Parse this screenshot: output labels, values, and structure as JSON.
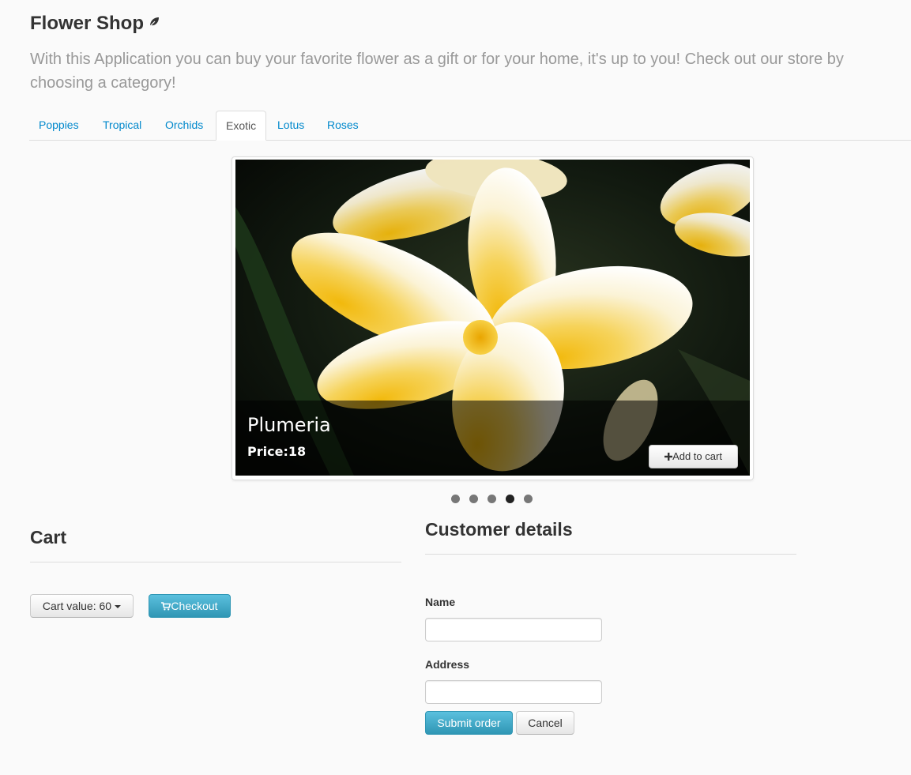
{
  "header": {
    "title": "Flower Shop",
    "icon": "leaf-icon",
    "lead": "With this Application you can buy your favorite flower as a gift or for your home, it's up to you! Check out our store by choosing a category!"
  },
  "tabs": [
    {
      "label": "Poppies",
      "active": false
    },
    {
      "label": "Tropical",
      "active": false
    },
    {
      "label": "Orchids",
      "active": false
    },
    {
      "label": "Exotic",
      "active": true
    },
    {
      "label": "Lotus",
      "active": false
    },
    {
      "label": "Roses",
      "active": false
    }
  ],
  "carousel": {
    "item_name": "Plumeria",
    "item_price": "Price:18",
    "add_to_cart_label": "Add to cart",
    "add_icon": "plus-icon",
    "slide_count": 5,
    "active_index": 3
  },
  "cart": {
    "title": "Cart",
    "cart_value_label": "Cart value: 60",
    "checkout_label": "Checkout",
    "checkout_icon": "shopping-cart-icon"
  },
  "customer": {
    "title": "Customer details",
    "name_label": "Name",
    "name_value": "",
    "address_label": "Address",
    "address_value": "",
    "submit_label": "Submit order",
    "cancel_label": "Cancel"
  },
  "colors": {
    "link": "#0088cc",
    "info_button": "#2f96b4",
    "muted_text": "#999999",
    "flower_yellow": "#f5c518"
  }
}
